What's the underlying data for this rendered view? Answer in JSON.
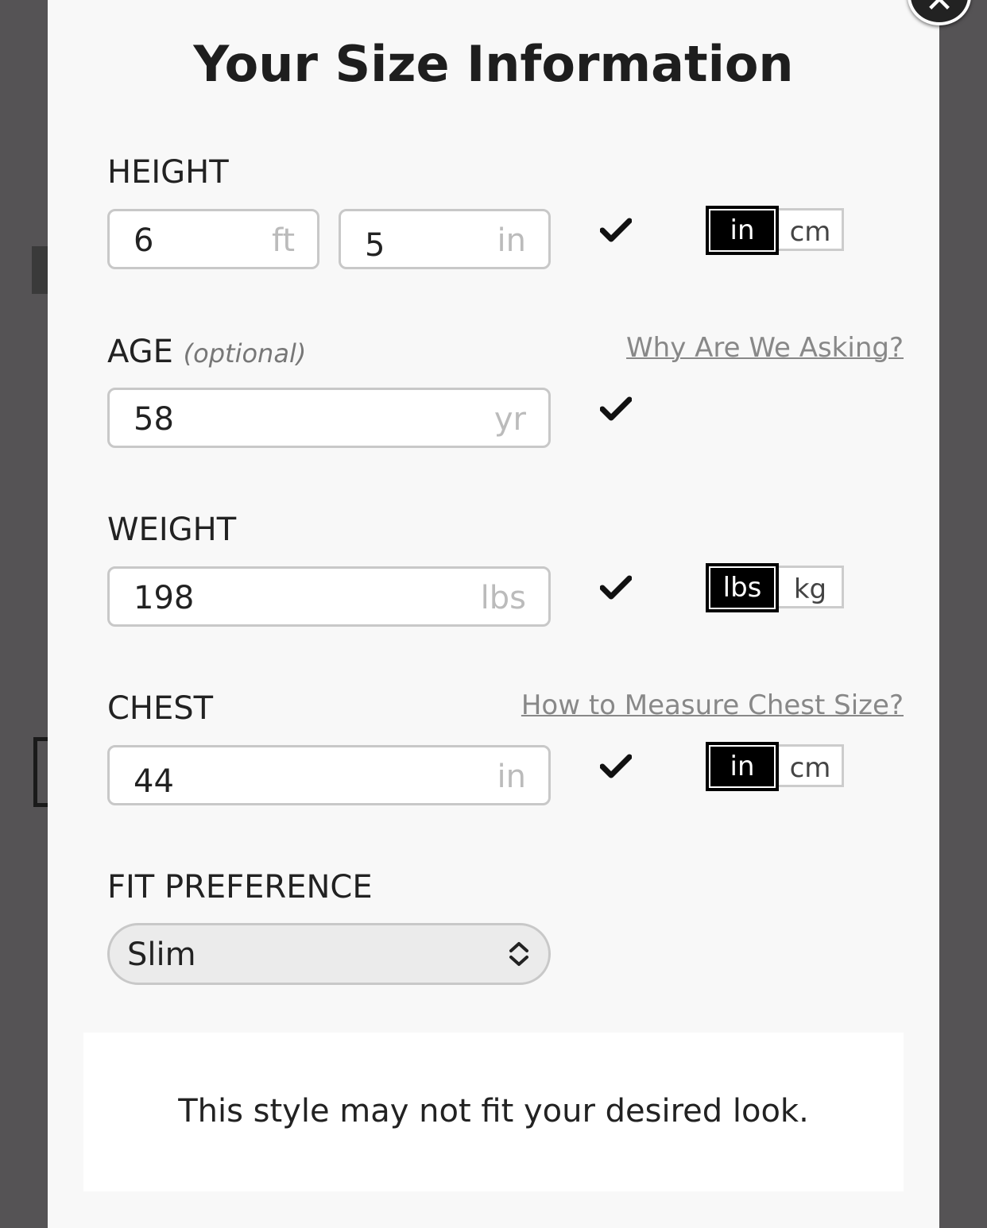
{
  "title": "Your Size Information",
  "height": {
    "label": "HEIGHT",
    "feet_value": "6",
    "feet_unit": "ft",
    "inches_value": "5",
    "inches_unit": "in",
    "units": {
      "active": "in",
      "inactive": "cm"
    }
  },
  "age": {
    "label": "AGE",
    "optional": "(optional)",
    "help_link": "Why Are We Asking?",
    "value": "58",
    "unit": "yr"
  },
  "weight": {
    "label": "WEIGHT",
    "value": "198",
    "unit": "lbs",
    "units": {
      "active": "lbs",
      "inactive": "kg"
    }
  },
  "chest": {
    "label": "CHEST",
    "help_link": "How to Measure Chest Size?",
    "value": "44",
    "unit": "in",
    "units": {
      "active": "in",
      "inactive": "cm"
    }
  },
  "fit": {
    "label": "FIT PREFERENCE",
    "selected": "Slim"
  },
  "notice": "This style may not fit your desired look.",
  "close_glyph": "✕",
  "colors": {
    "overlay": "#555355",
    "modal": "#f8f8f8",
    "active_toggle": "#000000"
  }
}
